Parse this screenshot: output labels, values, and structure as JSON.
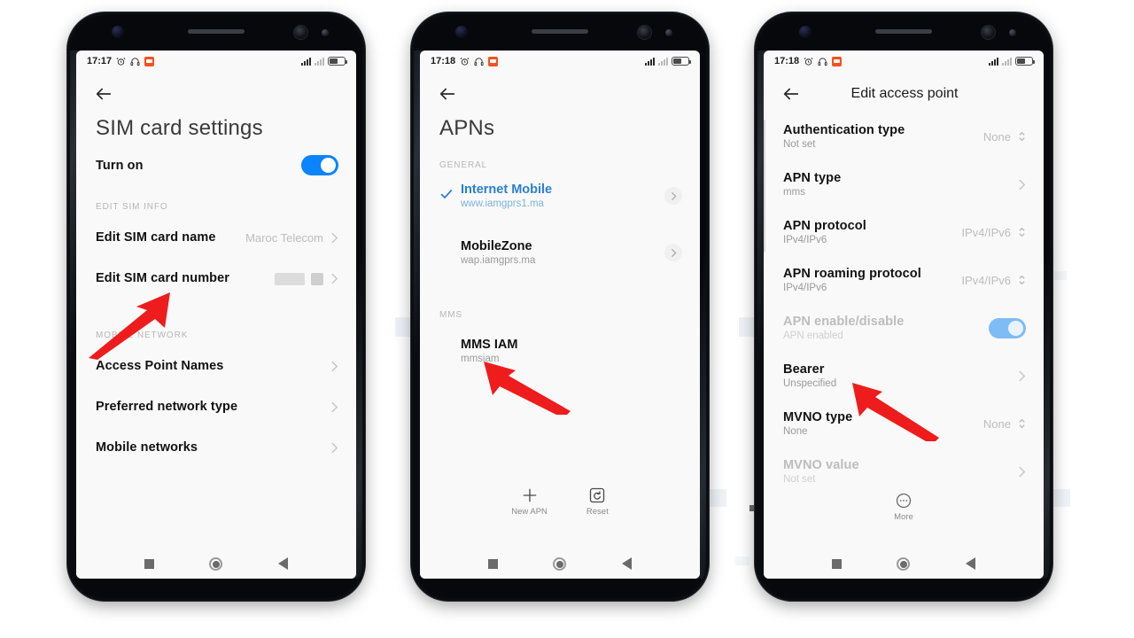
{
  "background": "#ffffff",
  "colors": {
    "accent_blue": "#0a84ff",
    "link_blue": "#2b7fd4",
    "annotation_red": "#ee1c1c",
    "muted_grey": "#9a9a9a",
    "notification_orange": "#f4511e"
  },
  "phones": [
    {
      "id": "phone-sim-card-settings",
      "status_bar": {
        "time": "17:17",
        "icons_left": [
          "alarm-icon",
          "headphone-icon",
          "message-icon"
        ],
        "icons_right": [
          "signal-bars-icon",
          "signal-bars-dim-icon",
          "battery-icon"
        ]
      },
      "back_button": "back-arrow-icon",
      "title": "SIM card settings",
      "rows": [
        {
          "title": "Turn on",
          "control": "toggle",
          "toggle_on": true
        }
      ],
      "sections": [
        {
          "label": "EDIT SIM INFO",
          "rows": [
            {
              "title": "Edit SIM card name",
              "value": "Maroc Telecom",
              "chevron": true
            },
            {
              "title": "Edit SIM card number",
              "value": "",
              "redacted": true,
              "chevron": true
            }
          ]
        },
        {
          "label": "MOBILE NETWORK",
          "rows": [
            {
              "title": "Access Point Names",
              "value": "",
              "chevron": true
            },
            {
              "title": "Preferred network type",
              "value": "",
              "chevron": true
            },
            {
              "title": "Mobile networks",
              "value": "",
              "chevron": true
            }
          ]
        }
      ],
      "nav": [
        "recents-square-icon",
        "home-circle-icon",
        "back-triangle-icon"
      ]
    },
    {
      "id": "phone-apns",
      "status_bar": {
        "time": "17:18",
        "icons_left": [
          "alarm-icon",
          "headphone-icon",
          "message-icon"
        ],
        "icons_right": [
          "signal-bars-icon",
          "signal-bars-dim-icon",
          "battery-icon"
        ]
      },
      "back_button": "back-arrow-icon",
      "title": "APNs",
      "sections": [
        {
          "label": "GENERAL",
          "items": [
            {
              "name": "Internet Mobile",
              "apn": "www.iamgprs1.ma",
              "selected": true
            },
            {
              "name": "MobileZone",
              "apn": "wap.iamgprs.ma",
              "selected": false
            }
          ]
        },
        {
          "label": "MMS",
          "items": [
            {
              "name": "MMS IAM",
              "apn": "mmsiam",
              "selected": false,
              "no_chevron": true
            }
          ]
        }
      ],
      "actions": [
        {
          "icon": "plus-icon",
          "label": "New APN"
        },
        {
          "icon": "reset-icon",
          "label": "Reset"
        }
      ],
      "nav": [
        "recents-square-icon",
        "home-circle-icon",
        "back-triangle-icon"
      ]
    },
    {
      "id": "phone-edit-access-point",
      "status_bar": {
        "time": "17:18",
        "icons_left": [
          "alarm-icon",
          "headphone-icon",
          "message-icon"
        ],
        "icons_right": [
          "signal-bars-icon",
          "signal-bars-dim-icon",
          "battery-icon"
        ]
      },
      "back_button": "back-arrow-icon",
      "title": "Edit access point",
      "rows": [
        {
          "title": "Authentication type",
          "sub": "Not set",
          "value": "None",
          "control": "stepper",
          "dim": false
        },
        {
          "title": "APN type",
          "sub": "mms",
          "value": "",
          "control": "chevron",
          "dim": false
        },
        {
          "title": "APN protocol",
          "sub": "IPv4/IPv6",
          "value": "IPv4/IPv6",
          "control": "stepper",
          "dim": false
        },
        {
          "title": "APN roaming protocol",
          "sub": "IPv4/IPv6",
          "value": "IPv4/IPv6",
          "control": "stepper",
          "dim": false
        },
        {
          "title": "APN enable/disable",
          "sub": "APN enabled",
          "value": "",
          "control": "toggle",
          "toggle_on": true,
          "dim": true
        },
        {
          "title": "Bearer",
          "sub": "Unspecified",
          "value": "",
          "control": "chevron",
          "dim": false
        },
        {
          "title": "MVNO type",
          "sub": "None",
          "value": "None",
          "control": "stepper",
          "dim": false
        },
        {
          "title": "MVNO value",
          "sub": "Not set",
          "value": "",
          "control": "chevron",
          "dim": true
        }
      ],
      "actions": [
        {
          "icon": "more-icon",
          "label": "More"
        }
      ],
      "nav": [
        "recents-square-icon",
        "home-circle-icon",
        "back-triangle-icon"
      ]
    }
  ],
  "annotations": [
    {
      "name": "arrow-to-edit-sim-card-number",
      "target": "Edit SIM card number"
    },
    {
      "name": "arrow-to-mms-iam",
      "target": "MMS IAM"
    },
    {
      "name": "arrow-to-bearer",
      "target": "Bearer"
    }
  ]
}
